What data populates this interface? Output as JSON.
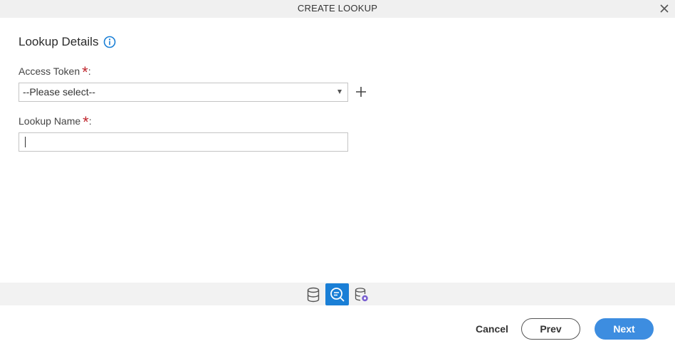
{
  "dialog": {
    "title": "CREATE LOOKUP"
  },
  "section": {
    "title": "Lookup Details"
  },
  "fields": {
    "access_token": {
      "label": "Access Token",
      "required_mark": "*",
      "colon": ":",
      "selected": "--Please select--"
    },
    "lookup_name": {
      "label": "Lookup Name",
      "required_mark": "*",
      "colon": ":",
      "value": ""
    }
  },
  "steps": [
    {
      "icon": "database-icon",
      "active": false
    },
    {
      "icon": "search-lookup-icon",
      "active": true
    },
    {
      "icon": "database-settings-icon",
      "active": false
    }
  ],
  "footer": {
    "cancel": "Cancel",
    "prev": "Prev",
    "next": "Next"
  },
  "colors": {
    "accent": "#1a7fd6",
    "next_button": "#3d8de0",
    "required": "#c0262d",
    "titlebar": "#f0f0f0"
  }
}
